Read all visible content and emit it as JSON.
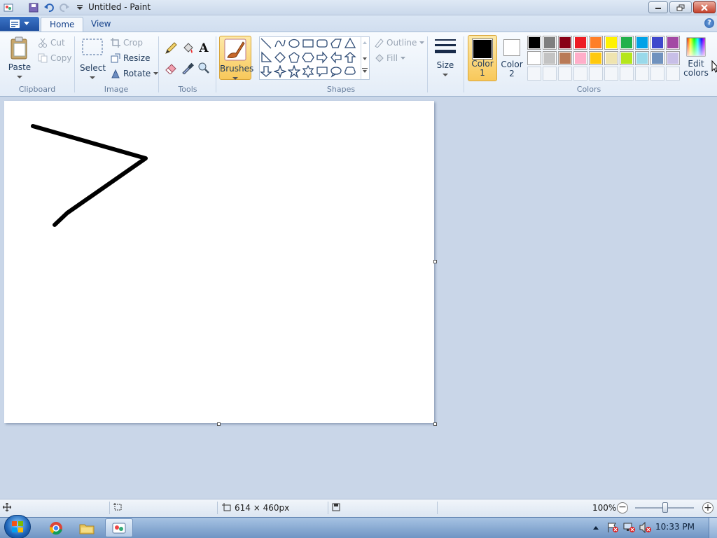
{
  "window": {
    "title": "Untitled - Paint",
    "minimize_label": "",
    "maximize_label": "",
    "close_label": ""
  },
  "tabs": [
    {
      "label": "Home",
      "active": true
    },
    {
      "label": "View",
      "active": false
    }
  ],
  "help_label": "?",
  "clipboard": {
    "paste": "Paste",
    "cut": "Cut",
    "copy": "Copy",
    "group": "Clipboard"
  },
  "image": {
    "select": "Select",
    "crop": "Crop",
    "resize": "Resize",
    "rotate": "Rotate",
    "group": "Image"
  },
  "tools": {
    "group": "Tools",
    "items": [
      "pencil-icon",
      "fill-icon",
      "text-icon",
      "eraser-icon",
      "color-picker-icon",
      "magnifier-icon"
    ]
  },
  "brushes": {
    "label": "Brushes"
  },
  "shapes": {
    "group": "Shapes",
    "outline": "Outline",
    "fill": "Fill"
  },
  "size": {
    "label": "Size"
  },
  "colors": {
    "group": "Colors",
    "color1_line1": "Color",
    "color1_line2": "1",
    "color2_line1": "Color",
    "color2_line2": "2",
    "edit_line1": "Edit",
    "edit_line2": "colors",
    "color1_value": "#000000",
    "color2_value": "#ffffff",
    "palette_row1": [
      "#000000",
      "#7f7f7f",
      "#880015",
      "#ed1c24",
      "#ff7f27",
      "#fff200",
      "#22b14c",
      "#00a2e8",
      "#3f48cc",
      "#a349a4"
    ],
    "palette_row2": [
      "#ffffff",
      "#c3c3c3",
      "#b97a57",
      "#ffaec9",
      "#ffc90e",
      "#efe4b0",
      "#b5e61d",
      "#99d9ea",
      "#7092be",
      "#c8bfe7"
    ]
  },
  "status": {
    "canvas_size": "614 × 460px",
    "zoom": "100%"
  },
  "taskbar": {
    "clock": "10:33 PM",
    "items": [
      "chrome-icon",
      "explorer-icon",
      "paint-icon"
    ]
  }
}
